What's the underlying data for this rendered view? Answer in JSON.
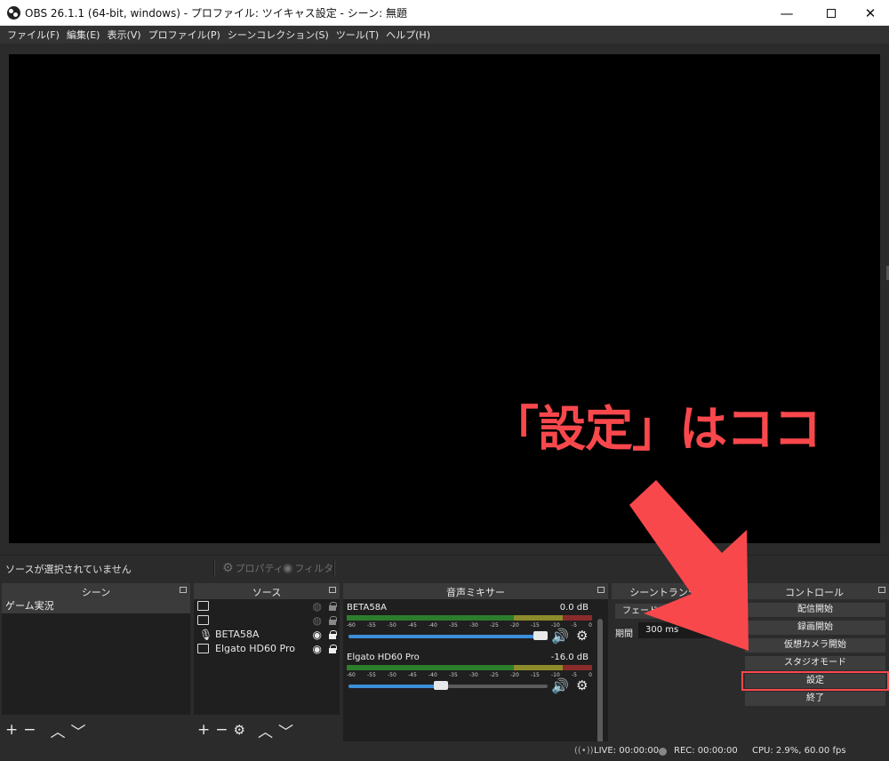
{
  "window": {
    "title": "OBS 26.1.1 (64-bit, windows) - プロファイル: ツイキャス設定 - シーン: 無題",
    "minimize": "—",
    "close": "✕"
  },
  "menu": [
    "ファイル(F)",
    "編集(E)",
    "表示(V)",
    "プロファイル(P)",
    "シーンコレクション(S)",
    "ツール(T)",
    "ヘルプ(H)"
  ],
  "annotation": {
    "text": "「設定」はココ",
    "color": "#f9484c"
  },
  "source_toolbar": {
    "status": "ソースが選択されていません",
    "properties": "プロパティ",
    "filters": "フィルタ"
  },
  "scenes": {
    "title": "シーン",
    "items": [
      "ゲーム実況"
    ]
  },
  "sources": {
    "title": "ソース",
    "items": [
      {
        "label": "",
        "icon": "camera-icon",
        "visible": false
      },
      {
        "label": "",
        "icon": "window-icon",
        "visible": false
      },
      {
        "label": "BETA58A",
        "icon": "microphone-icon",
        "visible": true
      },
      {
        "label": "Elgato HD60 Pro",
        "icon": "camera-icon",
        "visible": true
      }
    ]
  },
  "mixer": {
    "title": "音声ミキサー",
    "ticks": [
      "-60",
      "-55",
      "-50",
      "-45",
      "-40",
      "-35",
      "-30",
      "-25",
      "-20",
      "-15",
      "-10",
      "-5",
      "0"
    ],
    "channels": [
      {
        "name": "BETA58A",
        "db": "0.0 dB",
        "level": 1.0
      },
      {
        "name": "Elgato HD60 Pro",
        "db": "-16.0 dB",
        "level": 0.5
      }
    ]
  },
  "transitions": {
    "title": "シーントランジション",
    "selected": "フェード",
    "duration_label": "期間",
    "duration_value": "300 ms"
  },
  "controls": {
    "title": "コントロール",
    "buttons": [
      "配信開始",
      "録画開始",
      "仮想カメラ開始",
      "スタジオモード",
      "設定",
      "終了"
    ],
    "highlighted": "設定"
  },
  "status": {
    "live": "LIVE: 00:00:00",
    "rec": "REC: 00:00:00",
    "cpu": "CPU: 2.9%, 60.00 fps"
  },
  "colors": {
    "accent": "#f9484c",
    "fader": "#3b8fd9",
    "meter_green": "#2c7d2c",
    "meter_yellow": "#8d8b2a",
    "meter_red": "#8a2b2b"
  }
}
